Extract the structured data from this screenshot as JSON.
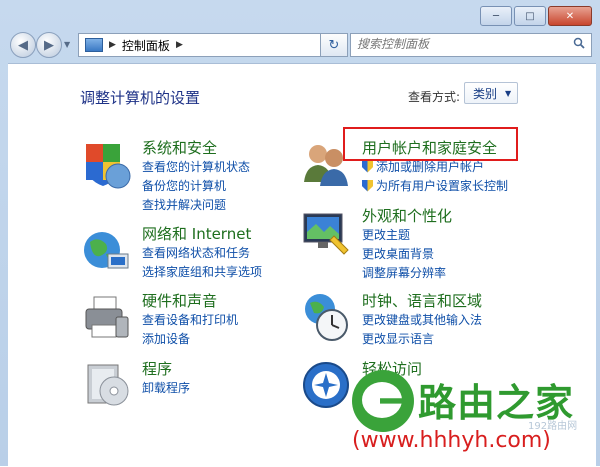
{
  "window": {
    "buttons": {
      "minimize": "─",
      "maximize": "□",
      "close": "✕"
    }
  },
  "nav": {
    "back_icon": "arrow-left-icon",
    "forward_icon": "arrow-right-icon",
    "address_crumb": "控制面板",
    "search_placeholder": "搜索控制面板"
  },
  "header": {
    "title": "调整计算机的设置",
    "view_by_label": "查看方式:",
    "view_by_value": "类别"
  },
  "categories_left": [
    {
      "heading": "系统和安全",
      "links": [
        "查看您的计算机状态",
        "备份您的计算机",
        "查找并解决问题"
      ],
      "icon": "shield-flag-icon"
    },
    {
      "heading": "网络和 Internet",
      "links": [
        "查看网络状态和任务",
        "选择家庭组和共享选项"
      ],
      "icon": "globe-network-icon"
    },
    {
      "heading": "硬件和声音",
      "links": [
        "查看设备和打印机",
        "添加设备"
      ],
      "icon": "printer-icon"
    },
    {
      "heading": "程序",
      "links": [
        "卸载程序"
      ],
      "icon": "programs-disc-icon"
    }
  ],
  "categories_right": [
    {
      "heading": "用户帐户和家庭安全",
      "links": [
        "添加或删除用户帐户",
        "为所有用户设置家长控制"
      ],
      "icon": "users-icon"
    },
    {
      "heading": "外观和个性化",
      "links": [
        "更改主题",
        "更改桌面背景",
        "调整屏幕分辨率"
      ],
      "icon": "monitor-paint-icon"
    },
    {
      "heading": "时钟、语言和区域",
      "links": [
        "更改键盘或其他输入法",
        "更改显示语言"
      ],
      "icon": "clock-globe-icon"
    },
    {
      "heading": "轻松访问",
      "links": [],
      "icon": "ease-of-access-icon"
    }
  ],
  "watermark": {
    "brand": "路由之家",
    "domain": "(www.hhhyh.com)",
    "tiny": "192路由网"
  },
  "colors": {
    "heading_green": "#1e6e1e",
    "link_blue": "#0f4fa8",
    "highlight_red": "#e01c1c"
  }
}
